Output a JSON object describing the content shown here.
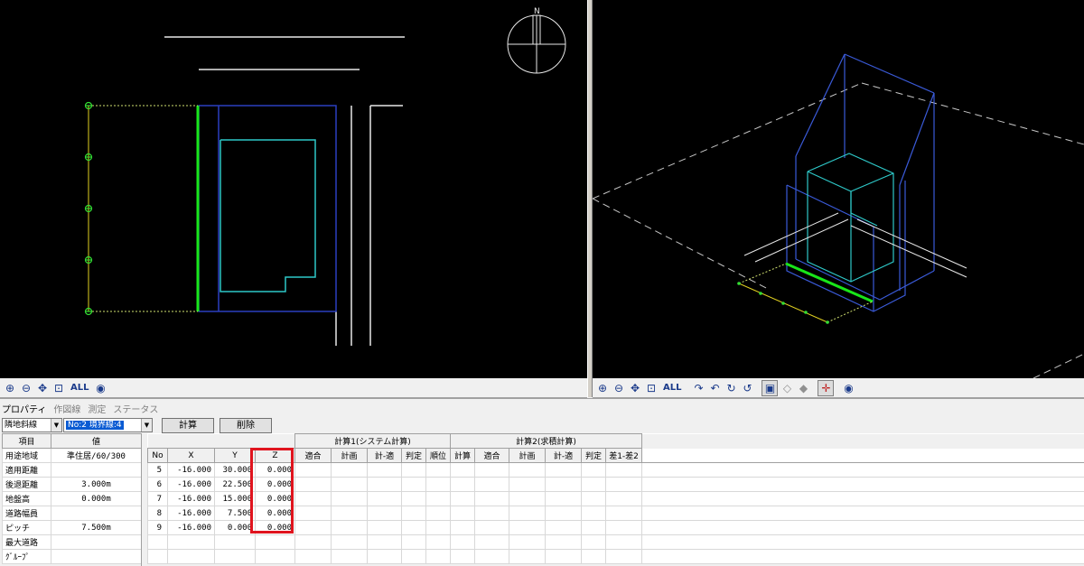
{
  "viewports": {
    "left_toolbar": {
      "all_label": "ALL"
    },
    "right_toolbar": {
      "all_label": "ALL"
    },
    "compass_label": "N"
  },
  "panel": {
    "tabs": [
      "プロパティ",
      "作図線",
      "測定",
      "ステータス"
    ],
    "combo_type": "隣地斜線",
    "combo_item": "No:2 境界線:4",
    "calc_button": "計算",
    "delete_button": "削除"
  },
  "properties": {
    "headers": [
      "項目",
      "値"
    ],
    "rows": [
      {
        "label": "用途地域",
        "value": "準住居/60/300"
      },
      {
        "label": "適用距離",
        "value": ""
      },
      {
        "label": "後退距離",
        "value": "3.000m"
      },
      {
        "label": "地盤高",
        "value": "0.000m"
      },
      {
        "label": "道路幅員",
        "value": ""
      },
      {
        "label": "ピッチ",
        "value": "7.500m"
      },
      {
        "label": "最大道路",
        "value": ""
      },
      {
        "label": "ｸﾞﾙｰﾌﾟ",
        "value": ""
      }
    ]
  },
  "grid": {
    "group1": "計算1(システム計算)",
    "group2": "計算2(求積計算)",
    "columns": [
      "No",
      "X",
      "Y",
      "Z",
      "適合",
      "計画",
      "計-適",
      "判定",
      "順位",
      "計算",
      "適合",
      "計画",
      "計-適",
      "判定",
      "差1-差2"
    ],
    "rows": [
      {
        "no": "5",
        "x": "-16.000",
        "y": "30.000",
        "z": "0.000"
      },
      {
        "no": "6",
        "x": "-16.000",
        "y": "22.500",
        "z": "0.000"
      },
      {
        "no": "7",
        "x": "-16.000",
        "y": "15.000",
        "z": "0.000"
      },
      {
        "no": "8",
        "x": "-16.000",
        "y": "7.500",
        "z": "0.000"
      },
      {
        "no": "9",
        "x": "-16.000",
        "y": "0.000",
        "z": "0.000"
      }
    ]
  },
  "colors": {
    "viewport_bg": "#000000",
    "boundary_green": "#19e619",
    "building_cyan": "#2ec8c8",
    "volume_blue": "#3a5ad8",
    "highlight_red": "#e0141e"
  }
}
